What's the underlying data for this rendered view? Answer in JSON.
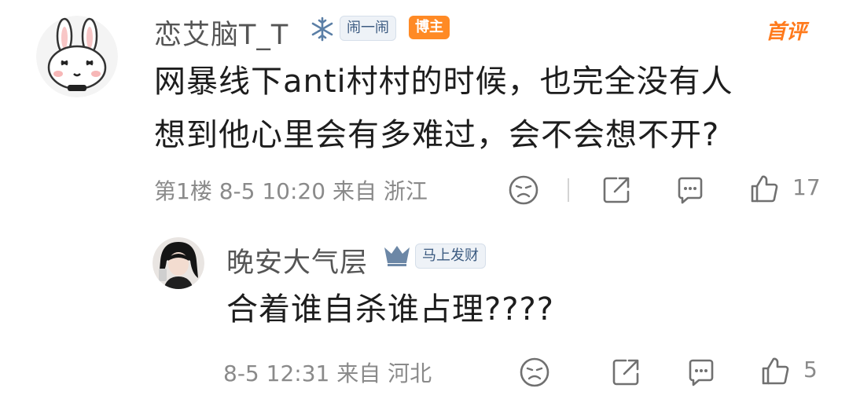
{
  "comment": {
    "username": "恋艾脑T_T",
    "badge_fan": "闹一闹",
    "badge_author": "博主",
    "first_label": "首评",
    "text_line1": "网暴线下anti村村的时候，也完全没有人",
    "text_line2": "想到他心里会有多难过，会不会想不开?",
    "floor": "第1楼",
    "datetime": "8-5 10:20",
    "location": "来自 浙江",
    "like_count": "17"
  },
  "reply": {
    "username": "晚安大气层",
    "badge": "马上发财",
    "text": "合着谁自杀谁占理????",
    "datetime": "8-5 12:31",
    "location": "来自 河北",
    "like_count": "5"
  },
  "colors": {
    "accent": "#ff8a25",
    "meta_gray": "#8a8a8a"
  }
}
